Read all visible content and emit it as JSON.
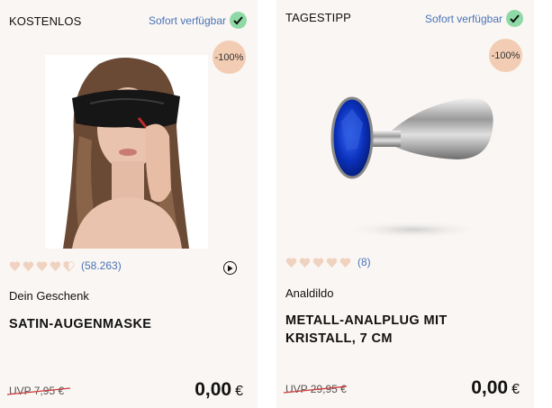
{
  "products": [
    {
      "badge": "KOSTENLOS",
      "availability": "Sofort verfügbar",
      "discount": "-100%",
      "rating_count": "(58.263)",
      "rating": 4.5,
      "category": "Dein Geschenk",
      "title": "SATIN-AUGENMASKE",
      "uvp": "UVP 7,95 €",
      "price": "0,00",
      "currency": "€",
      "image": "woman-eye-mask-photo"
    },
    {
      "badge": "TAGESTIPP",
      "availability": "Sofort verfügbar",
      "discount": "-100%",
      "rating_count": "(8)",
      "rating": 5,
      "category": "Analdildo",
      "title": "METALL-ANALPLUG MIT KRISTALL, 7 CM",
      "uvp": "UVP 29,95 €",
      "price": "0,00",
      "currency": "€",
      "image": "metal-plug-blue-crystal-photo"
    }
  ],
  "colors": {
    "card_bg": "#faf6f3",
    "link": "#4a73b8",
    "check_bg": "#8fd9a6",
    "discount_bg": "#f2cdb3",
    "heart": "#f0d2c0",
    "strike": "#cc3b3b"
  }
}
